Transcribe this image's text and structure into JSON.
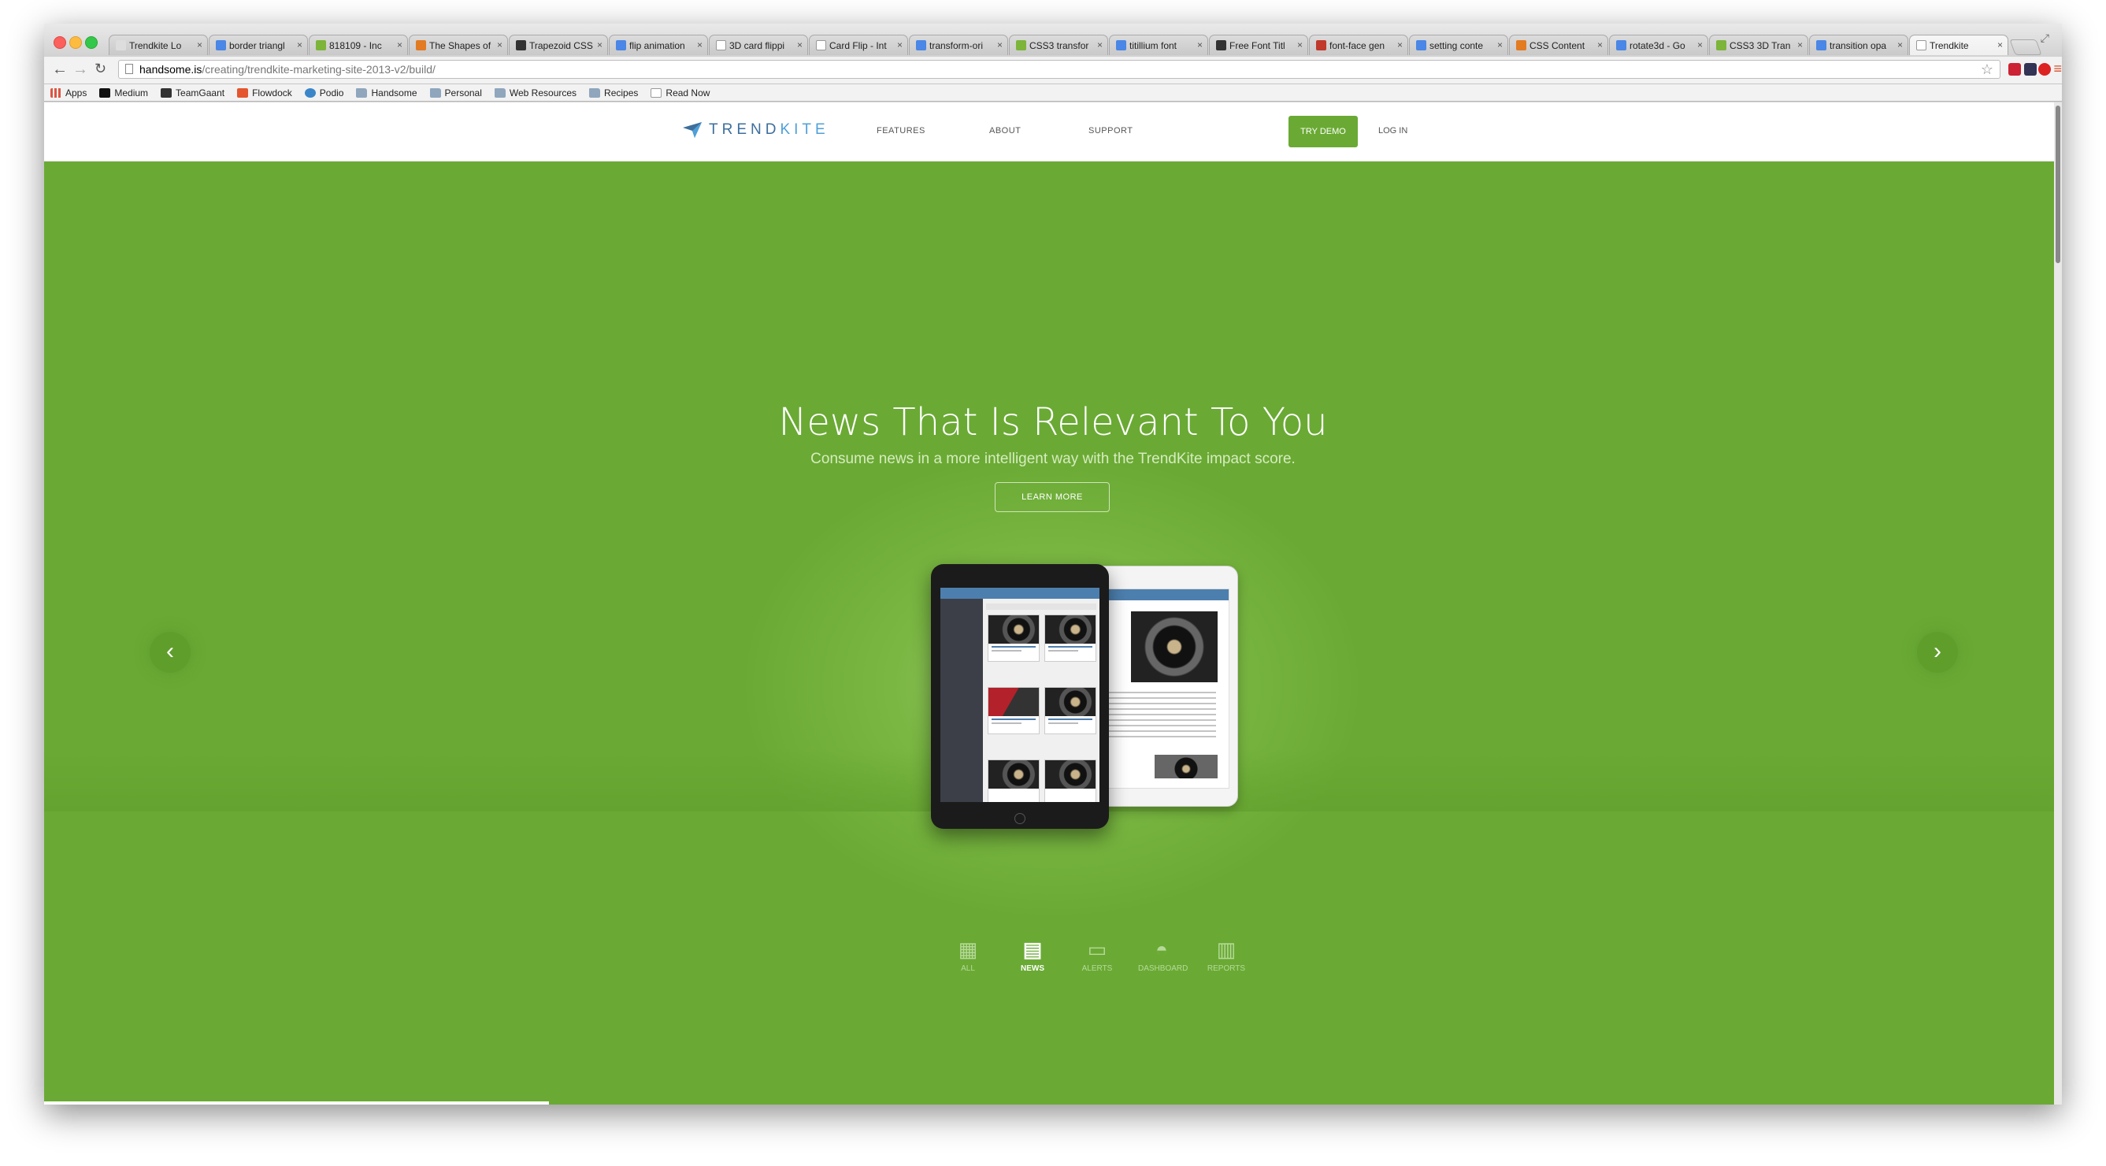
{
  "browser": {
    "tabs": [
      {
        "title": "Trendkite Lo",
        "icon": "w"
      },
      {
        "title": "border triangl",
        "icon": "g"
      },
      {
        "title": "818109 - Inc",
        "icon": "gr"
      },
      {
        "title": "The Shapes of",
        "icon": "o"
      },
      {
        "title": "Trapezoid CSS",
        "icon": "dk"
      },
      {
        "title": "flip animation",
        "icon": "g"
      },
      {
        "title": "3D card flippi",
        "icon": "doc"
      },
      {
        "title": "Card Flip - Int",
        "icon": "doc"
      },
      {
        "title": "transform-ori",
        "icon": "g"
      },
      {
        "title": "CSS3 transfor",
        "icon": "gr"
      },
      {
        "title": "titillium font",
        "icon": "g"
      },
      {
        "title": "Free Font Titl",
        "icon": "dk"
      },
      {
        "title": "font-face gen",
        "icon": "r"
      },
      {
        "title": "setting conte",
        "icon": "g"
      },
      {
        "title": "CSS Content",
        "icon": "o"
      },
      {
        "title": "rotate3d - Go",
        "icon": "g"
      },
      {
        "title": "CSS3 3D Tran",
        "icon": "gr"
      },
      {
        "title": "transition opa",
        "icon": "g"
      },
      {
        "title": "Trendkite",
        "icon": "doc",
        "active": true
      }
    ],
    "url_host": "handsome.is",
    "url_path": "/creating/trendkite-marketing-site-2013-v2/build/",
    "bookmarks": [
      "Apps",
      "Medium",
      "TeamGaant",
      "Flowdock",
      "Podio",
      "Handsome",
      "Personal",
      "Web Resources",
      "Recipes",
      "Read Now"
    ]
  },
  "site": {
    "logo_part1": "TREND",
    "logo_part2": "KITE",
    "nav": {
      "features": "FEATURES",
      "about": "ABOUT",
      "support": "SUPPORT"
    },
    "try_demo": "TRY DEMO",
    "login": "LOG IN",
    "hero": {
      "title": "News That Is Relevant To You",
      "subtitle": "Consume news in a more intelligent way with the TrendKite impact score.",
      "cta": "LEARN MORE"
    },
    "features": [
      {
        "label": "ALL",
        "icon": "grid-icon"
      },
      {
        "label": "NEWS",
        "icon": "news-icon",
        "active": true
      },
      {
        "label": "ALERTS",
        "icon": "chat-icon"
      },
      {
        "label": "DASHBOARD",
        "icon": "dashboard-icon"
      },
      {
        "label": "REPORTS",
        "icon": "report-icon"
      }
    ],
    "accent_color": "#6aaa34",
    "slider_progress": 0.25
  }
}
